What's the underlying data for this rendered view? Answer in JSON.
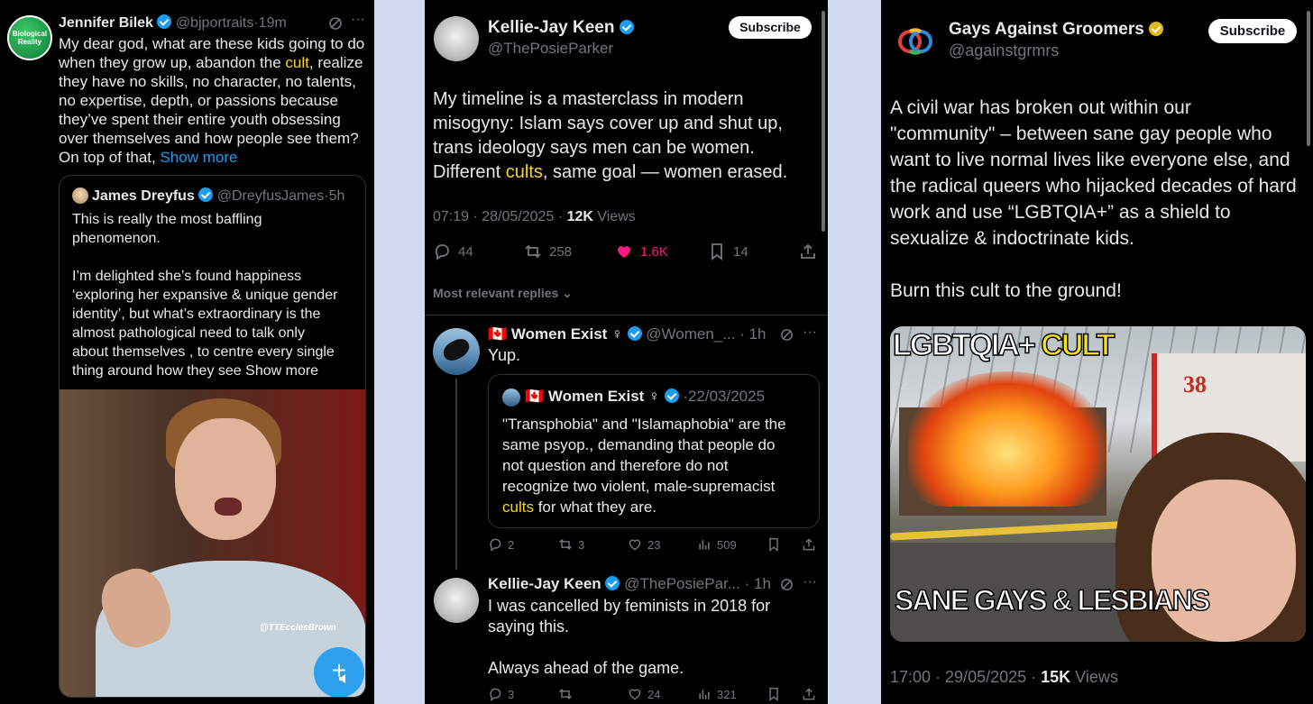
{
  "panel1": {
    "avatar_text": "Biological Reality",
    "author_name": "Jennifer Bilek",
    "author_handle": "@bjportraits",
    "time": "19m",
    "body_lines": [
      "My dear god, what are these kids going to do",
      "when they grow up, abandon the ",
      "cult",
      ", realize",
      "they have no skills, no character, no talents,",
      "no expertise, depth, or passions because",
      "they’ve spent their entire youth obsessing",
      "over themselves and how people see them?",
      "On top of that, "
    ],
    "show_more": "Show more",
    "quote": {
      "author_name": "James Dreyfus",
      "author_handle": "@DreyfusJames",
      "time": "5h",
      "para1": [
        "This is really the most baffling",
        "phenomenon."
      ],
      "para2": [
        "I’m delighted she’s found happiness",
        "‘exploring her expansive & unique gender",
        "identity’, but what’s extraordinary is the",
        "almost pathological need to talk only",
        "about themselves , to centre every single",
        "thing around how they see "
      ],
      "show_more": "Show more",
      "video_watermark": "@TTEcclesBrown"
    }
  },
  "panel2": {
    "author_name": "Kellie-Jay Keen",
    "author_handle": "@ThePosieParker",
    "subscribe_label": "Subscribe",
    "body_lines": [
      "My timeline is a masterclass in modern",
      "misogyny: Islam says cover up and shut up,",
      "trans ideology says men can be women.",
      "Different ",
      "cults",
      ", same goal — women erased."
    ],
    "timestamp": "07:19 · 28/05/2025 · ",
    "views_count": "12K",
    "views_label": " Views",
    "stats": {
      "replies": "44",
      "reposts": "258",
      "likes": "1.6K",
      "bookmarks": "14"
    },
    "replies_filter": "Most relevant replies",
    "reply1": {
      "flag": "🇨🇦",
      "author_name": "Women Exist ♀",
      "author_handle": "@Women_...",
      "time": "1h",
      "text": "Yup.",
      "quote": {
        "flag": "🇨🇦",
        "author_name": "Women Exist ♀",
        "date": "22/03/2025",
        "lines": [
          "\"Transphobia\" and \"Islamaphobia\" are the",
          "same psyop.,  demanding that people do",
          "not question and therefore do not",
          "recognize two violent, male-supremacist",
          "cults",
          " for what they are."
        ]
      },
      "stats": {
        "replies": "2",
        "reposts": "3",
        "likes": "23",
        "views": "509"
      }
    },
    "reply2": {
      "author_name": "Kellie-Jay Keen",
      "author_handle": "@ThePosiePar...",
      "time": "1h",
      "lines": [
        "I was cancelled by feminists in 2018 for",
        "saying this.",
        "",
        "Always ahead of the game."
      ],
      "stats": {
        "replies": "3",
        "reposts": "",
        "likes": "24",
        "views": "321"
      }
    }
  },
  "panel3": {
    "author_name": "Gays Against Groomers",
    "author_handle": "@againstgrmrs",
    "subscribe_label": "Subscribe",
    "body_lines": [
      "A civil war has broken out within our",
      "\"community\" – between sane gay people who",
      "want to live normal lives like everyone else, and",
      "the radical queers who hijacked decades of hard",
      "work and use “LGBTQIA+” as a shield to",
      "sexualize & indoctrinate kids.",
      "",
      "Burn this cult to the ground!"
    ],
    "meme": {
      "top_text_1": "LGBTQIA+ ",
      "top_text_2": "CULT",
      "bottom_text": "SANE GAYS & LESBIANS",
      "truck_number": "38"
    },
    "timestamp": "17:00 · 29/05/2025 · ",
    "views_count": "15K",
    "views_label": " Views"
  },
  "colors": {
    "accent_blue": "#1d9bf0",
    "like_pink": "#f91880",
    "highlight_yellow": "#f7d618",
    "gold_badge": "#e2b719"
  },
  "icons": [
    "reply-icon",
    "repost-icon",
    "like-icon",
    "bookmark-icon",
    "share-icon",
    "views-icon",
    "grok-icon",
    "more-icon",
    "verified-badge-icon"
  ]
}
